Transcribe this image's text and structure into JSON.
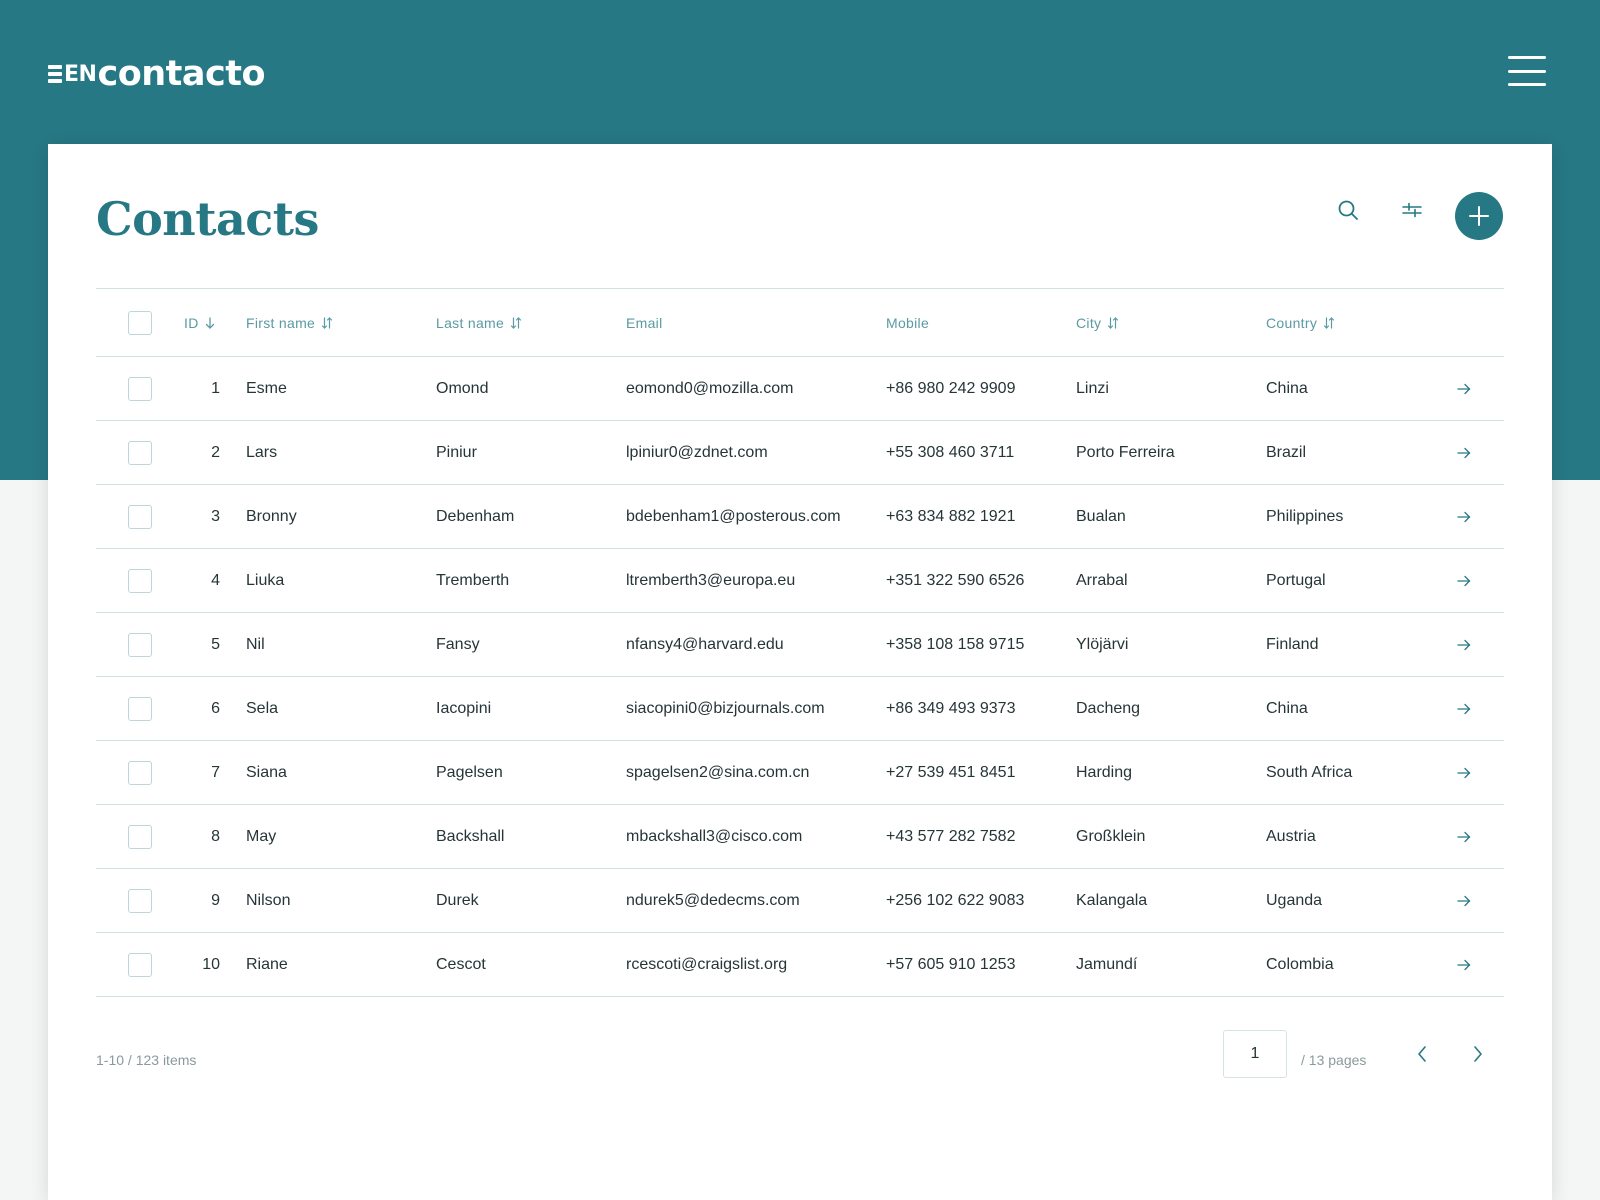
{
  "brand": {
    "prefix": "EN",
    "name": "contacto"
  },
  "colors": {
    "primary": "#267884",
    "border": "#cfe1e3",
    "header_text": "#5a9aa4"
  },
  "page": {
    "title": "Contacts"
  },
  "toolbar": {
    "icons": [
      "search-icon",
      "sliders-icon",
      "plus-icon"
    ]
  },
  "table": {
    "columns": {
      "id": "ID",
      "first_name": "First name",
      "last_name": "Last name",
      "email": "Email",
      "mobile": "Mobile",
      "city": "City",
      "country": "Country"
    },
    "rows": [
      {
        "id": "1",
        "first": "Esme",
        "last": "Omond",
        "email": "eomond0@mozilla.com",
        "mobile": "+86 980 242 9909",
        "city": "Linzi",
        "country": "China"
      },
      {
        "id": "2",
        "first": "Lars",
        "last": "Piniur",
        "email": "lpiniur0@zdnet.com",
        "mobile": "+55 308 460 3711",
        "city": "Porto Ferreira",
        "country": "Brazil"
      },
      {
        "id": "3",
        "first": "Bronny",
        "last": "Debenham",
        "email": "bdebenham1@posterous.com",
        "mobile": "+63 834 882 1921",
        "city": "Bualan",
        "country": "Philippines"
      },
      {
        "id": "4",
        "first": "Liuka",
        "last": "Tremberth",
        "email": "ltremberth3@europa.eu",
        "mobile": "+351 322 590 6526",
        "city": "Arrabal",
        "country": "Portugal"
      },
      {
        "id": "5",
        "first": "Nil",
        "last": "Fansy",
        "email": "nfansy4@harvard.edu",
        "mobile": "+358 108 158 9715",
        "city": "Ylöjärvi",
        "country": "Finland"
      },
      {
        "id": "6",
        "first": "Sela",
        "last": "Iacopini",
        "email": "siacopini0@bizjournals.com",
        "mobile": "+86 349 493 9373",
        "city": "Dacheng",
        "country": "China"
      },
      {
        "id": "7",
        "first": "Siana",
        "last": "Pagelsen",
        "email": "spagelsen2@sina.com.cn",
        "mobile": "+27 539 451 8451",
        "city": "Harding",
        "country": "South Africa"
      },
      {
        "id": "8",
        "first": "May",
        "last": "Backshall",
        "email": "mbackshall3@cisco.com",
        "mobile": "+43 577 282 7582",
        "city": "Großklein",
        "country": "Austria"
      },
      {
        "id": "9",
        "first": "Nilson",
        "last": "Durek",
        "email": "ndurek5@dedecms.com",
        "mobile": "+256 102 622 9083",
        "city": "Kalangala",
        "country": "Uganda"
      },
      {
        "id": "10",
        "first": "Riane",
        "last": "Cescot",
        "email": "rcescoti@craigslist.org",
        "mobile": "+57 605 910 1253",
        "city": "Jamundí",
        "country": "Colombia"
      }
    ]
  },
  "pagination": {
    "summary": "1-10 / 123 items",
    "current_page": "1",
    "total_label": "/ 13 pages"
  }
}
